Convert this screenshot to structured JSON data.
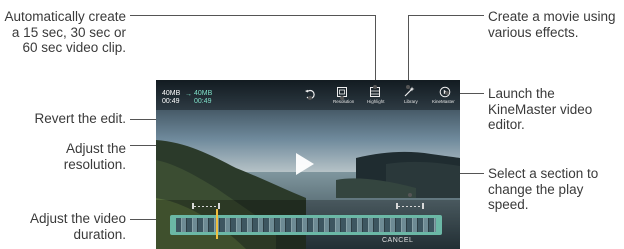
{
  "callouts": {
    "auto_clip": "Automatically create a 15 sec, 30 sec or 60 sec video clip.",
    "revert": "Revert the edit.",
    "resolution": "Adjust the resolution.",
    "duration": "Adjust the video duration.",
    "movie": "Create a movie using various effects.",
    "kinemaster": "Launch the KineMaster video editor.",
    "speed": "Select a section to change the play speed."
  },
  "screen": {
    "original_size": "40MB",
    "original_time": "00:49",
    "edited_size": "40MB",
    "edited_time": "00:49",
    "toolbar": {
      "resolution_label": "Resolution",
      "highlight_label": "Highlight",
      "library_label": "Library",
      "kinemaster_label": "KineMaster"
    },
    "cancel_label": "CANCEL"
  },
  "colors": {
    "timeline_accent": "#6bb8a6",
    "playhead": "#f0c040",
    "time_green": "#7fe0c8"
  }
}
